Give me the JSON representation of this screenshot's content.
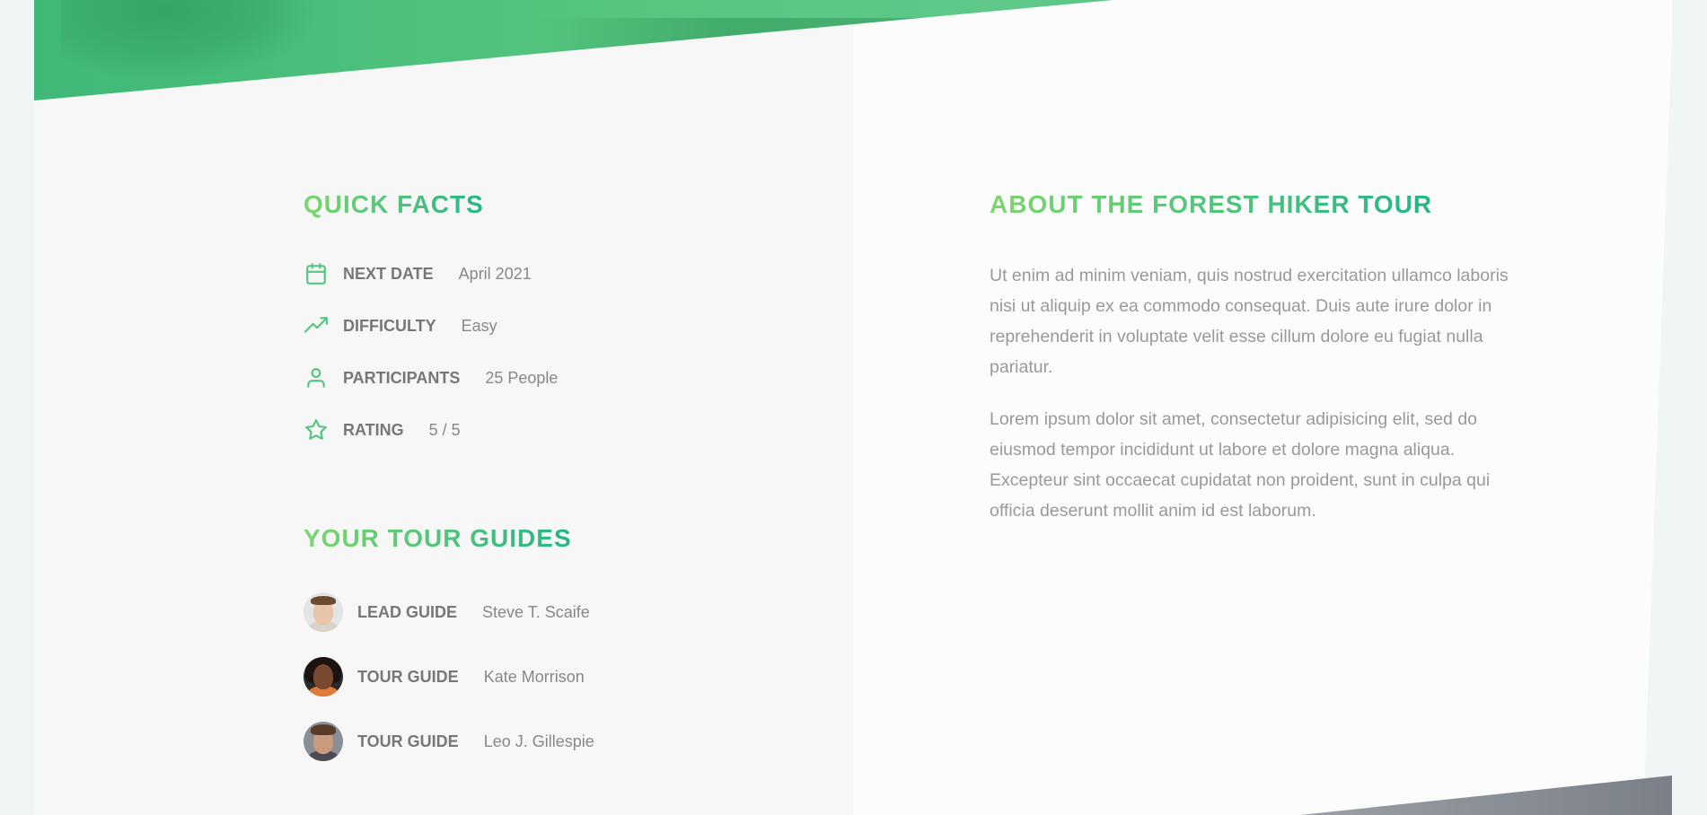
{
  "quick_facts": {
    "title": "Quick Facts",
    "items": [
      {
        "label": "Next date",
        "value": "April 2021",
        "icon": "calendar-icon"
      },
      {
        "label": "Difficulty",
        "value": "Easy",
        "icon": "trending-up-icon"
      },
      {
        "label": "Participants",
        "value": "25 People",
        "icon": "user-icon"
      },
      {
        "label": "Rating",
        "value": "5 / 5",
        "icon": "star-icon"
      }
    ]
  },
  "guides": {
    "title": "Your tour guides",
    "items": [
      {
        "role": "Lead guide",
        "name": "Steve T. Scaife"
      },
      {
        "role": "Tour guide",
        "name": "Kate Morrison"
      },
      {
        "role": "Tour guide",
        "name": "Leo J. Gillespie"
      }
    ]
  },
  "about": {
    "title": "About the Forest Hiker Tour",
    "paragraphs": [
      "Ut enim ad minim veniam, quis nostrud exercitation ullamco laboris nisi ut aliquip ex ea commodo consequat. Duis aute irure dolor in reprehenderit in voluptate velit esse cillum dolore eu fugiat nulla pariatur.",
      "Lorem ipsum dolor sit amet, consectetur adipisicing elit, sed do eiusmod tempor incididunt ut labore et dolore magna aliqua. Excepteur sint occaecat cupidatat non proident, sunt in culpa qui officia deserunt mollit anim id est laborum."
    ]
  },
  "colors": {
    "accent_light": "#7dd56f",
    "accent_dark": "#28b487",
    "icon": "#55c57f"
  }
}
